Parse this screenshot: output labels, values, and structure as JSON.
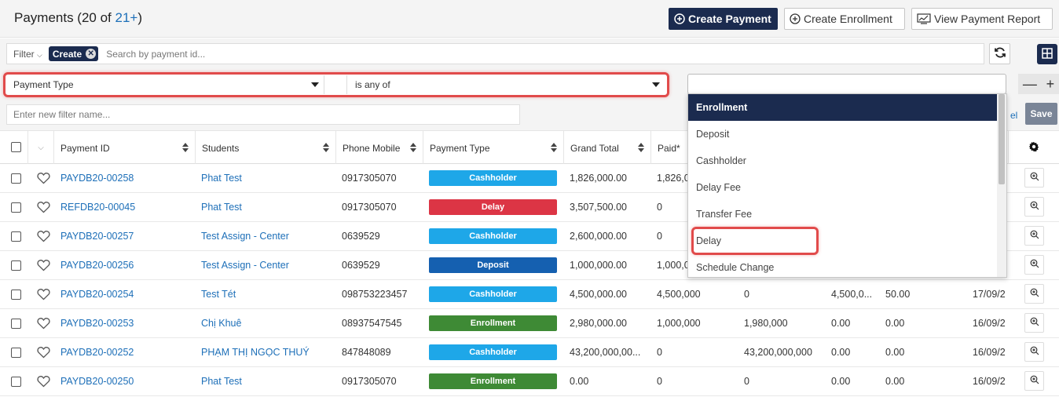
{
  "header": {
    "title_prefix": "Payments (20 of ",
    "title_count": "21+",
    "title_suffix": ")",
    "create_payment": "Create Payment",
    "create_enrollment": "Create Enrollment",
    "view_report": "View Payment Report"
  },
  "filter": {
    "label": "Filter",
    "chip": "Create",
    "search_placeholder": "Search by payment id..."
  },
  "rule": {
    "field": "Payment Type",
    "operator": "is any of",
    "new_filter_placeholder": "Enter new filter name...",
    "save": "Save",
    "cancel_fragment": "el"
  },
  "dropdown": {
    "options": [
      "Enrollment",
      "Deposit",
      "Cashholder",
      "Delay Fee",
      "Transfer Fee",
      "Delay",
      "Schedule Change"
    ],
    "selected": "Enrollment",
    "highlighted": "Delay"
  },
  "columns": [
    "Payment ID",
    "Students",
    "Phone Mobile",
    "Payment Type",
    "Grand Total",
    "Paid*"
  ],
  "rows": [
    {
      "id": "PAYDB20-00258",
      "student": "Phat Test",
      "phone": "0917305070",
      "type": "Cashholder",
      "grand": "1,826,000.00",
      "paid": "1,826,0",
      "c7": "",
      "c8": "",
      "c9": "",
      "c10": ""
    },
    {
      "id": "REFDB20-00045",
      "student": "Phat Test",
      "phone": "0917305070",
      "type": "Delay",
      "grand": "3,507,500.00",
      "paid": "0",
      "c7": "",
      "c8": "",
      "c9": "",
      "c10": ""
    },
    {
      "id": "PAYDB20-00257",
      "student": "Test Assign - Center",
      "phone": "0639529",
      "type": "Cashholder",
      "grand": "2,600,000.00",
      "paid": "0",
      "c7": "",
      "c8": "",
      "c9": "",
      "c10": ""
    },
    {
      "id": "PAYDB20-00256",
      "student": "Test Assign - Center",
      "phone": "0639529",
      "type": "Deposit",
      "grand": "1,000,000.00",
      "paid": "1,000,0",
      "c7": "",
      "c8": "",
      "c9": "",
      "c10": ""
    },
    {
      "id": "PAYDB20-00254",
      "student": "Test Tét",
      "phone": "098753223457",
      "type": "Cashholder",
      "grand": "4,500,000.00",
      "paid": "4,500,000",
      "c7": "0",
      "c8": "4,500,0...",
      "c9": "50.00",
      "c10": "17/09/2"
    },
    {
      "id": "PAYDB20-00253",
      "student": "Chị Khuê",
      "phone": "08937547545",
      "type": "Enrollment",
      "grand": "2,980,000.00",
      "paid": "1,000,000",
      "c7": "1,980,000",
      "c8": "0.00",
      "c9": "0.00",
      "c10": "16/09/2"
    },
    {
      "id": "PAYDB20-00252",
      "student": "PHẠM THỊ NGỌC THUÝ",
      "phone": "847848089",
      "type": "Cashholder",
      "grand": "43,200,000,00...",
      "paid": "0",
      "c7": "43,200,000,000",
      "c8": "0.00",
      "c9": "0.00",
      "c10": "16/09/2"
    },
    {
      "id": "PAYDB20-00250",
      "student": "Phat Test",
      "phone": "0917305070",
      "type": "Enrollment",
      "grand": "0.00",
      "paid": "0",
      "c7": "0",
      "c8": "0.00",
      "c9": "0.00",
      "c10": "16/09/2"
    }
  ],
  "badge_colors": {
    "Cashholder": "#1ea7e8",
    "Delay": "#dc3545",
    "Deposit": "#1560b0",
    "Enrollment": "#3e8a35"
  }
}
